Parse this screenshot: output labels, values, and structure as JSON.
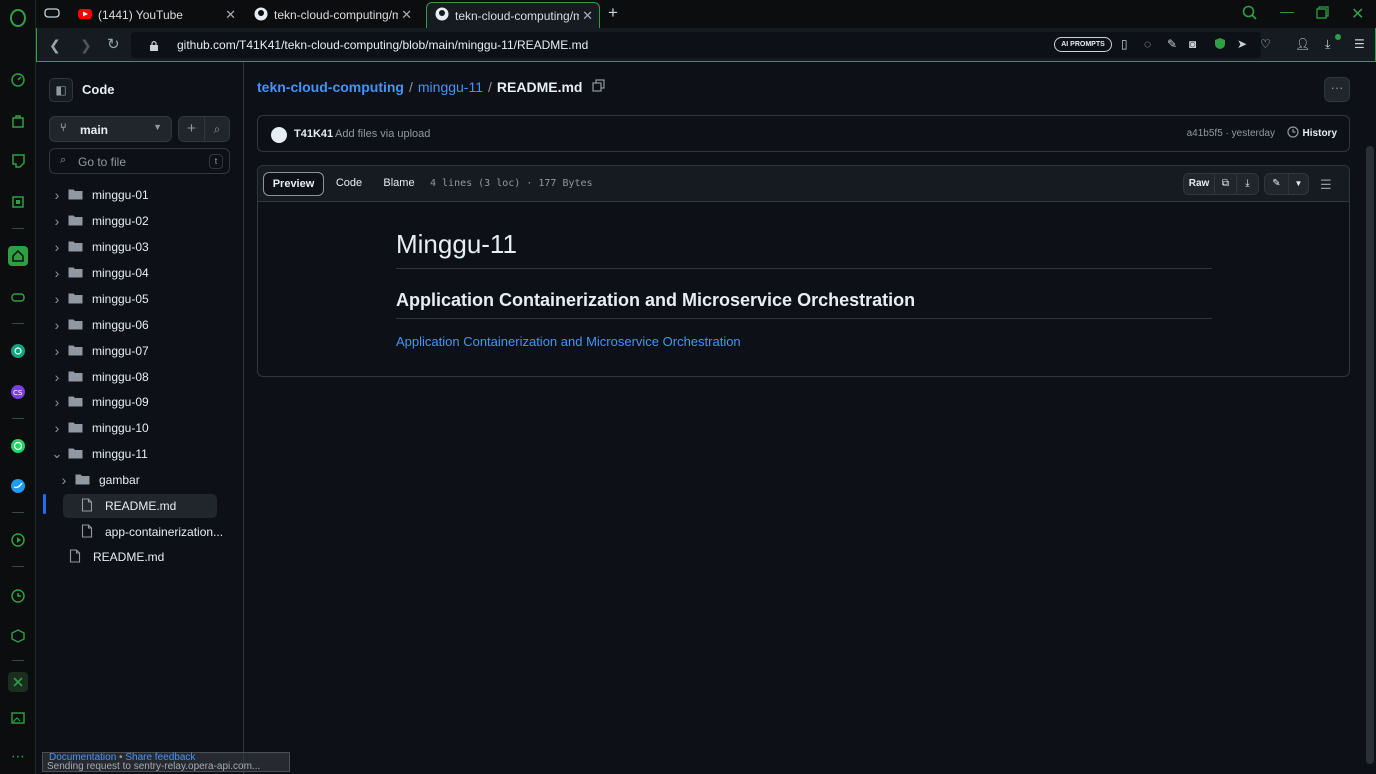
{
  "browser": {
    "tabs": [
      {
        "title": "(1441) YouTube",
        "icon": "youtube-icon"
      },
      {
        "title": "tekn-cloud-computing/min",
        "icon": "github-icon"
      },
      {
        "title": "tekn-cloud-computing/min",
        "icon": "github-icon",
        "active": true
      }
    ],
    "url": "github.com/T41K41/tekn-cloud-computing/blob/main/minggu-11/README.md",
    "ai_prompts": "AI PROMPTS",
    "status_text": "Sending request to sentry-relay.opera-api.com..."
  },
  "tree": {
    "title": "Code",
    "branch": "main",
    "goto_placeholder": "Go to file",
    "goto_shortcut": "t",
    "items": [
      {
        "label": "minggu-01",
        "type": "folder"
      },
      {
        "label": "minggu-02",
        "type": "folder"
      },
      {
        "label": "minggu-03",
        "type": "folder"
      },
      {
        "label": "minggu-04",
        "type": "folder"
      },
      {
        "label": "minggu-05",
        "type": "folder"
      },
      {
        "label": "minggu-06",
        "type": "folder"
      },
      {
        "label": "minggu-07",
        "type": "folder"
      },
      {
        "label": "minggu-08",
        "type": "folder"
      },
      {
        "label": "minggu-09",
        "type": "folder"
      },
      {
        "label": "minggu-10",
        "type": "folder"
      },
      {
        "label": "minggu-11",
        "type": "folder-open"
      },
      {
        "label": "gambar",
        "type": "folder"
      },
      {
        "label": "README.md",
        "type": "file",
        "selected": true
      },
      {
        "label": "app-containerization...",
        "type": "file"
      },
      {
        "label": "README.md",
        "type": "file"
      }
    ]
  },
  "breadcrumb": {
    "repo": "tekn-cloud-computing",
    "folder": "minggu-11",
    "file": "README.md",
    "sep": "/"
  },
  "commit": {
    "author": "T41K41",
    "message": "Add files via upload",
    "sha": "a41b5f5 · yesterday",
    "history": "History"
  },
  "file_toolbar": {
    "preview": "Preview",
    "code": "Code",
    "blame": "Blame",
    "meta": "4 lines (3 loc) · 177 Bytes",
    "raw": "Raw"
  },
  "markdown": {
    "h1": "Minggu-11",
    "h2": "Application Containerization and Microservice Orchestration",
    "link": "Application Containerization and Microservice Orchestration"
  },
  "footer": {
    "documentation": "Documentation",
    "bullet": "•",
    "feedback": "Share feedback"
  },
  "colors": {
    "accent_green": "#2ea043",
    "link_blue": "#4493f8",
    "bg": "#0d1117"
  }
}
